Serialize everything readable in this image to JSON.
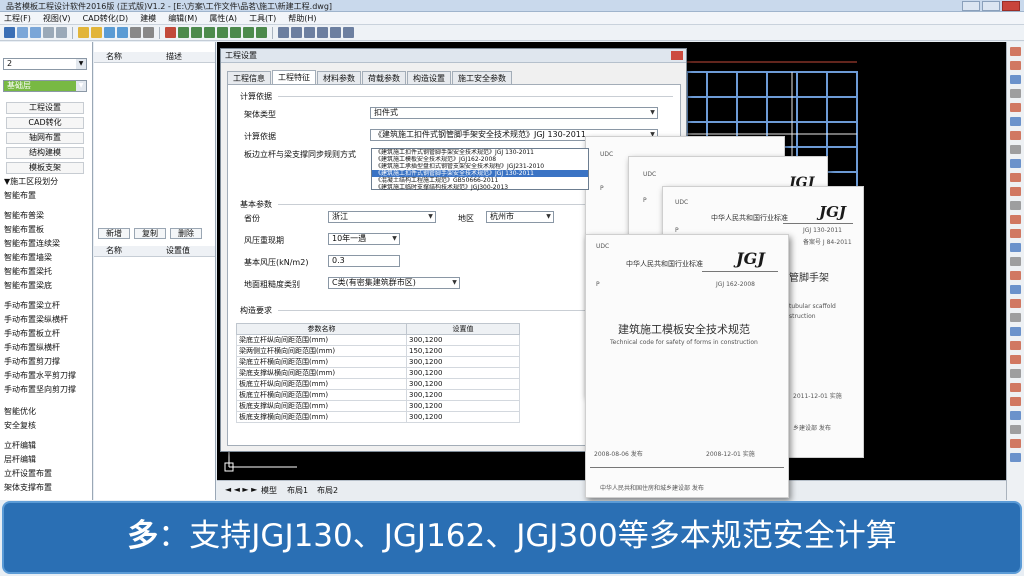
{
  "window": {
    "title": "品茗模板工程设计软件2016版 (正式版)V1.2 - [E:\\方案\\工作文件\\品茗\\施工\\新建工程.dwg]"
  },
  "menu": [
    "工程(F)",
    "视图(V)",
    "CAD转化(D)",
    "建模",
    "编辑(M)",
    "属性(A)",
    "工具(T)",
    "帮助(H)"
  ],
  "left_panel": {
    "floor_value": "2",
    "component_type": "基础层",
    "buttons": [
      "工程设置",
      "CAD转化",
      "轴网布置",
      "结构建模",
      "模板支架"
    ],
    "tree_items": [
      "▼施工区段划分",
      "智能布置",
      "智能布普梁",
      "智能布置板",
      "智能布置连续梁",
      "智能布置墙梁",
      "智能布置梁托",
      "智能布置梁底",
      "手动布置梁立杆",
      "手动布置梁纵横杆",
      "手动布置板立杆",
      "手动布置纵横杆",
      "手动布置剪刀撑",
      "手动布置水平剪刀撑",
      "手动布置坚向剪刀撑",
      "智能优化",
      "安全复核",
      "立杆编辑",
      "层杆编辑",
      "立杆设置布置",
      "架体支撑布置"
    ]
  },
  "mid_panel": {
    "col_name": "名称",
    "col_desc": "描述",
    "buttons": [
      "新增",
      "复制",
      "删除"
    ],
    "col_name2": "名称",
    "col_value2": "设置值"
  },
  "dialog": {
    "title": "工程设置",
    "tabs": [
      "工程信息",
      "工程特征",
      "材料参数",
      "荷载参数",
      "构造设置",
      "施工安全参数"
    ],
    "active_tab": 1,
    "calc_basis": {
      "section": "计算依据",
      "frame_type_label": "架体类型",
      "frame_type_value": "扣件式",
      "basis_label": "计算依据",
      "basis_value": "《建筑施工扣件式钢管脚手架安全技术规范》JGJ 130-2011",
      "link_label": "板边立杆与梁支撑同步规则方式",
      "options": [
        "《建筑施工扣件式钢管脚手架安全技术规范》JGJ 130-2011",
        "《建筑施工模板安全技术规范》JGJ162-2008",
        "《建筑施工承插型盘扣式钢管支架安全技术规程》JGJ231-2010",
        "《建筑施工扣件式钢管脚手架安全技术规范》JGJ 130-2011",
        "《混凝土结构工程施工规范》GB50666-2011",
        "《建筑施工临时支撑结构技术规范》JGJ300-2013"
      ]
    },
    "basic": {
      "section": "基本参数",
      "province_label": "省份",
      "province_value": "浙江",
      "area_label": "地区",
      "area_value": "杭州市",
      "wind_label": "风压重现期",
      "wind_value": "10年一遇",
      "wind_pressure_label": "基本风压(kN/m2)",
      "wind_pressure_value": "0.3",
      "rough_label": "地面粗糙度类别",
      "rough_value": "C类(有密集建筑群市区)"
    },
    "construct": {
      "section": "构造要求",
      "col_param": "参数名称",
      "col_value": "设置值",
      "rows": [
        [
          "梁底立杆纵向间距范围(mm)",
          "300,1200"
        ],
        [
          "梁两侧立杆横向间距范围(mm)",
          "150,1200"
        ],
        [
          "梁底立杆横向间距范围(mm)",
          "300,1200"
        ],
        [
          "梁底支撑纵横向间距范围(mm)",
          "300,1200"
        ],
        [
          "板底立杆纵向间距范围(mm)",
          "300,1200"
        ],
        [
          "板底立杆横向间距范围(mm)",
          "300,1200"
        ],
        [
          "板底支撑纵向间距范围(mm)",
          "300,1200"
        ],
        [
          "板底支撑横向间距范围(mm)",
          "300,1200"
        ]
      ]
    }
  },
  "layout_tabs": [
    "模型",
    "布局1",
    "布局2"
  ],
  "books": [
    {
      "udc": "UDC",
      "p": "P",
      "code": "JGJ",
      "number": "JGJ 130-2011",
      "record": "备案号 J 84-2011",
      "national": "中华人民共和国行业标准",
      "title_fragment": "管脚手架",
      "en_fragment": "tubular scaffold",
      "en2": "struction",
      "date": "2011-12-01 实施",
      "ministry": "乡建设部 发布"
    },
    {
      "udc": "UDC",
      "p": "P",
      "code": "JGJ",
      "number": "JGJ 162-2008",
      "national": "中华人民共和国行业标准",
      "title": "建筑施工模板安全技术规范",
      "en_title": "Technical code for safety of forms in construction",
      "release_date": "2008-08-06 发布",
      "impl_date": "2008-12-01 实施",
      "ministry": "中华人民共和国住房和城乡建设部 发布"
    }
  ],
  "banner": {
    "lead": "多",
    "text": "：支持JGJ130、JGJ162、JGJ300等多本规范安全计算"
  }
}
